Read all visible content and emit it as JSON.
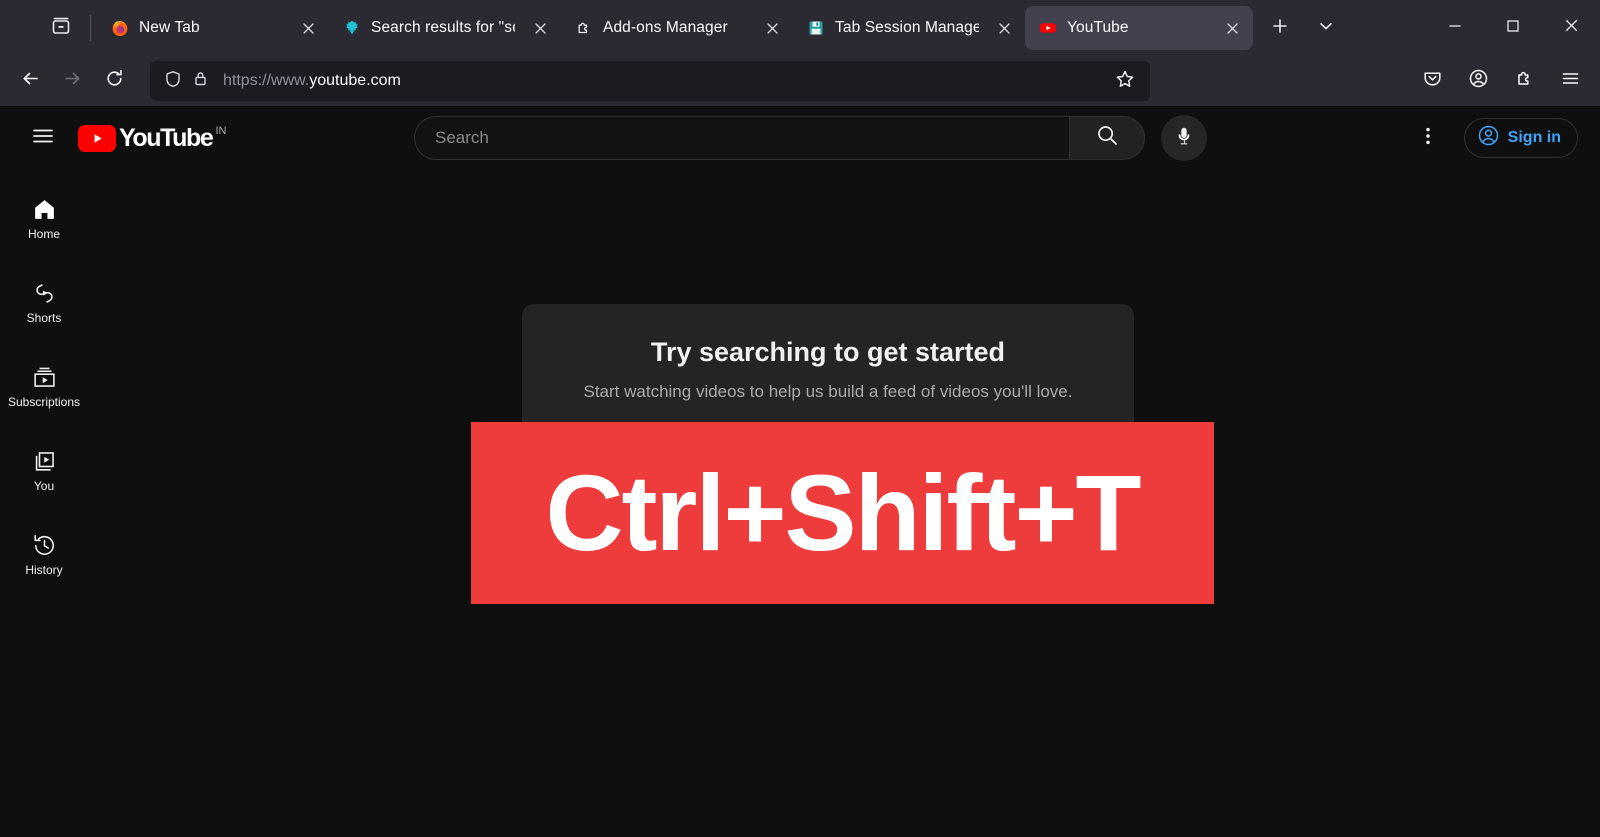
{
  "browser": {
    "firefox_view_icon": "tab-list-icon",
    "tabs": [
      {
        "title": "New Tab",
        "favicon": "firefox-logo-icon",
        "active": false,
        "close_icon": "close-icon"
      },
      {
        "title": "Search results for \"sessio",
        "favicon": "addons-puzzle-icon",
        "active": false,
        "close_icon": "close-icon"
      },
      {
        "title": "Add-ons Manager",
        "favicon": "addon-extension-icon",
        "active": false,
        "close_icon": "close-icon"
      },
      {
        "title": "Tab Session Manager",
        "favicon": "floppy-disk-save-icon",
        "active": false,
        "close_icon": "close-icon"
      },
      {
        "title": "YouTube",
        "favicon": "youtube-play-icon",
        "active": true,
        "close_icon": "close-icon"
      }
    ],
    "new_tab_icon": "plus-icon",
    "list_all_tabs_icon": "chevron-down-icon",
    "window_controls": {
      "minimize": "minimize-icon",
      "maximize": "maximize-icon",
      "close": "close-icon"
    },
    "nav": {
      "back_icon": "arrow-left-icon",
      "forward_icon": "arrow-right-icon",
      "reload_icon": "reload-icon",
      "shield_icon": "shield-icon",
      "lock_icon": "padlock-icon",
      "url_scheme": "https://www.",
      "url_domain": "youtube.com",
      "bookmark_icon": "star-icon",
      "pocket_icon": "pocket-icon",
      "account_icon": "account-circle-icon",
      "extensions_icon": "extensions-puzzle-icon",
      "menu_icon": "hamburger-menu-icon"
    }
  },
  "youtube": {
    "header": {
      "guide_icon": "hamburger-menu-icon",
      "logo_icon": "youtube-play-logo-icon",
      "logo_text": "YouTube",
      "country_code": "IN",
      "search_placeholder": "Search",
      "search_value": "",
      "search_icon": "magnifier-icon",
      "voice_search_icon": "microphone-icon",
      "settings_icon": "vertical-dots-icon",
      "signin_icon": "account-circle-icon",
      "signin_label": "Sign in"
    },
    "sidebar": [
      {
        "label": "Home",
        "icon": "home-icon"
      },
      {
        "label": "Shorts",
        "icon": "shorts-icon"
      },
      {
        "label": "Subscriptions",
        "icon": "subscriptions-icon"
      },
      {
        "label": "You",
        "icon": "you-library-icon"
      },
      {
        "label": "History",
        "icon": "history-clock-icon"
      }
    ],
    "promo": {
      "title": "Try searching to get started",
      "subtitle": "Start watching videos to help us build a feed of videos you'll love."
    },
    "banner": {
      "text": "Ctrl+Shift+T",
      "background_color": "#ee3b3b",
      "text_color": "#ffffff"
    }
  },
  "colors": {
    "chrome_bg": "#2b2a33",
    "urlbar_bg": "#1c1b22",
    "active_tab_bg": "#42414d",
    "page_bg": "#0f0f0f",
    "card_bg": "#242424",
    "youtube_red": "#ff0000",
    "link_blue": "#3ea6ff"
  }
}
